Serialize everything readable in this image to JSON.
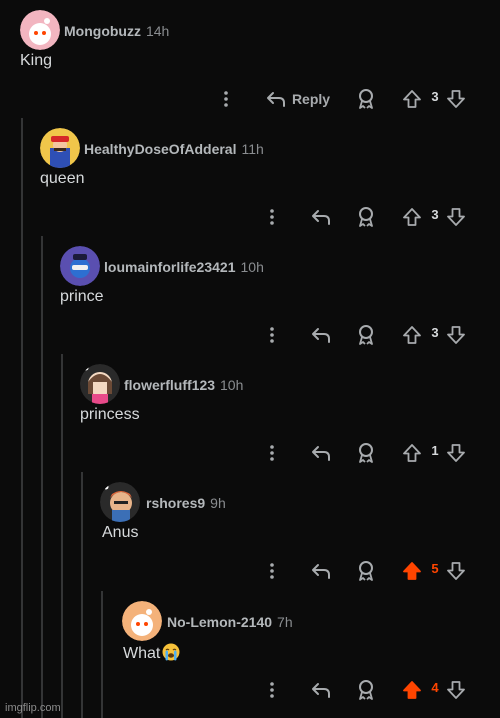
{
  "comments": [
    {
      "username": "Mongobuzz",
      "time": "14h",
      "body": "King",
      "score": "3",
      "upvoted": false,
      "reply_label": "Reply"
    },
    {
      "username": "HealthyDoseOfAdderal",
      "time": "11h",
      "body": "queen",
      "score": "3",
      "upvoted": false
    },
    {
      "username": "loumainforlife23421",
      "time": "10h",
      "body": "prince",
      "score": "3",
      "upvoted": false
    },
    {
      "username": "flowerfluff123",
      "time": "10h",
      "body": "princess",
      "score": "1",
      "upvoted": false
    },
    {
      "username": "rshores9",
      "time": "9h",
      "body": "Anus",
      "score": "5",
      "upvoted": true
    },
    {
      "username": "No-Lemon-2140",
      "time": "7h",
      "body": "What",
      "score": "4",
      "upvoted": true
    }
  ],
  "emoji": "loudly-crying-face",
  "watermark": "imgflip.com",
  "colors": {
    "background": "#0b0b0b",
    "upvote": "#ff4500",
    "thread_line": "#343536",
    "text": "#d7dadc"
  }
}
